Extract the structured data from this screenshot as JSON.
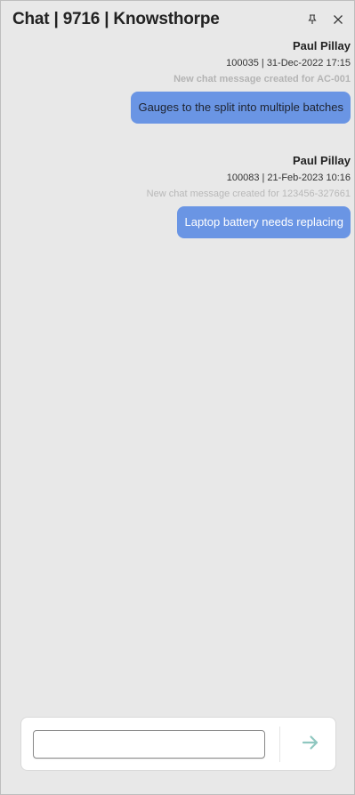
{
  "header": {
    "title": "Chat | 9716 | Knowsthorpe",
    "pin_icon": "pin-icon",
    "close_icon": "close-icon"
  },
  "messages": [
    {
      "sender": "Paul Pillay",
      "meta": "100035 | 31-Dec-2022 17:15",
      "note": "New chat message created for AC-001",
      "text": "Gauges to the split into multiple batches"
    },
    {
      "sender": "Paul Pillay",
      "meta": "100083 | 21-Feb-2023 10:16",
      "note": "New chat message created for 123456-327661",
      "text": "Laptop battery needs replacing"
    }
  ],
  "composer": {
    "input_value": "",
    "input_placeholder": "",
    "send_icon": "arrow-right-icon"
  },
  "colors": {
    "bubble": "#6a95e4",
    "send_arrow": "#8fc7c0",
    "background": "#e8e8e8"
  }
}
